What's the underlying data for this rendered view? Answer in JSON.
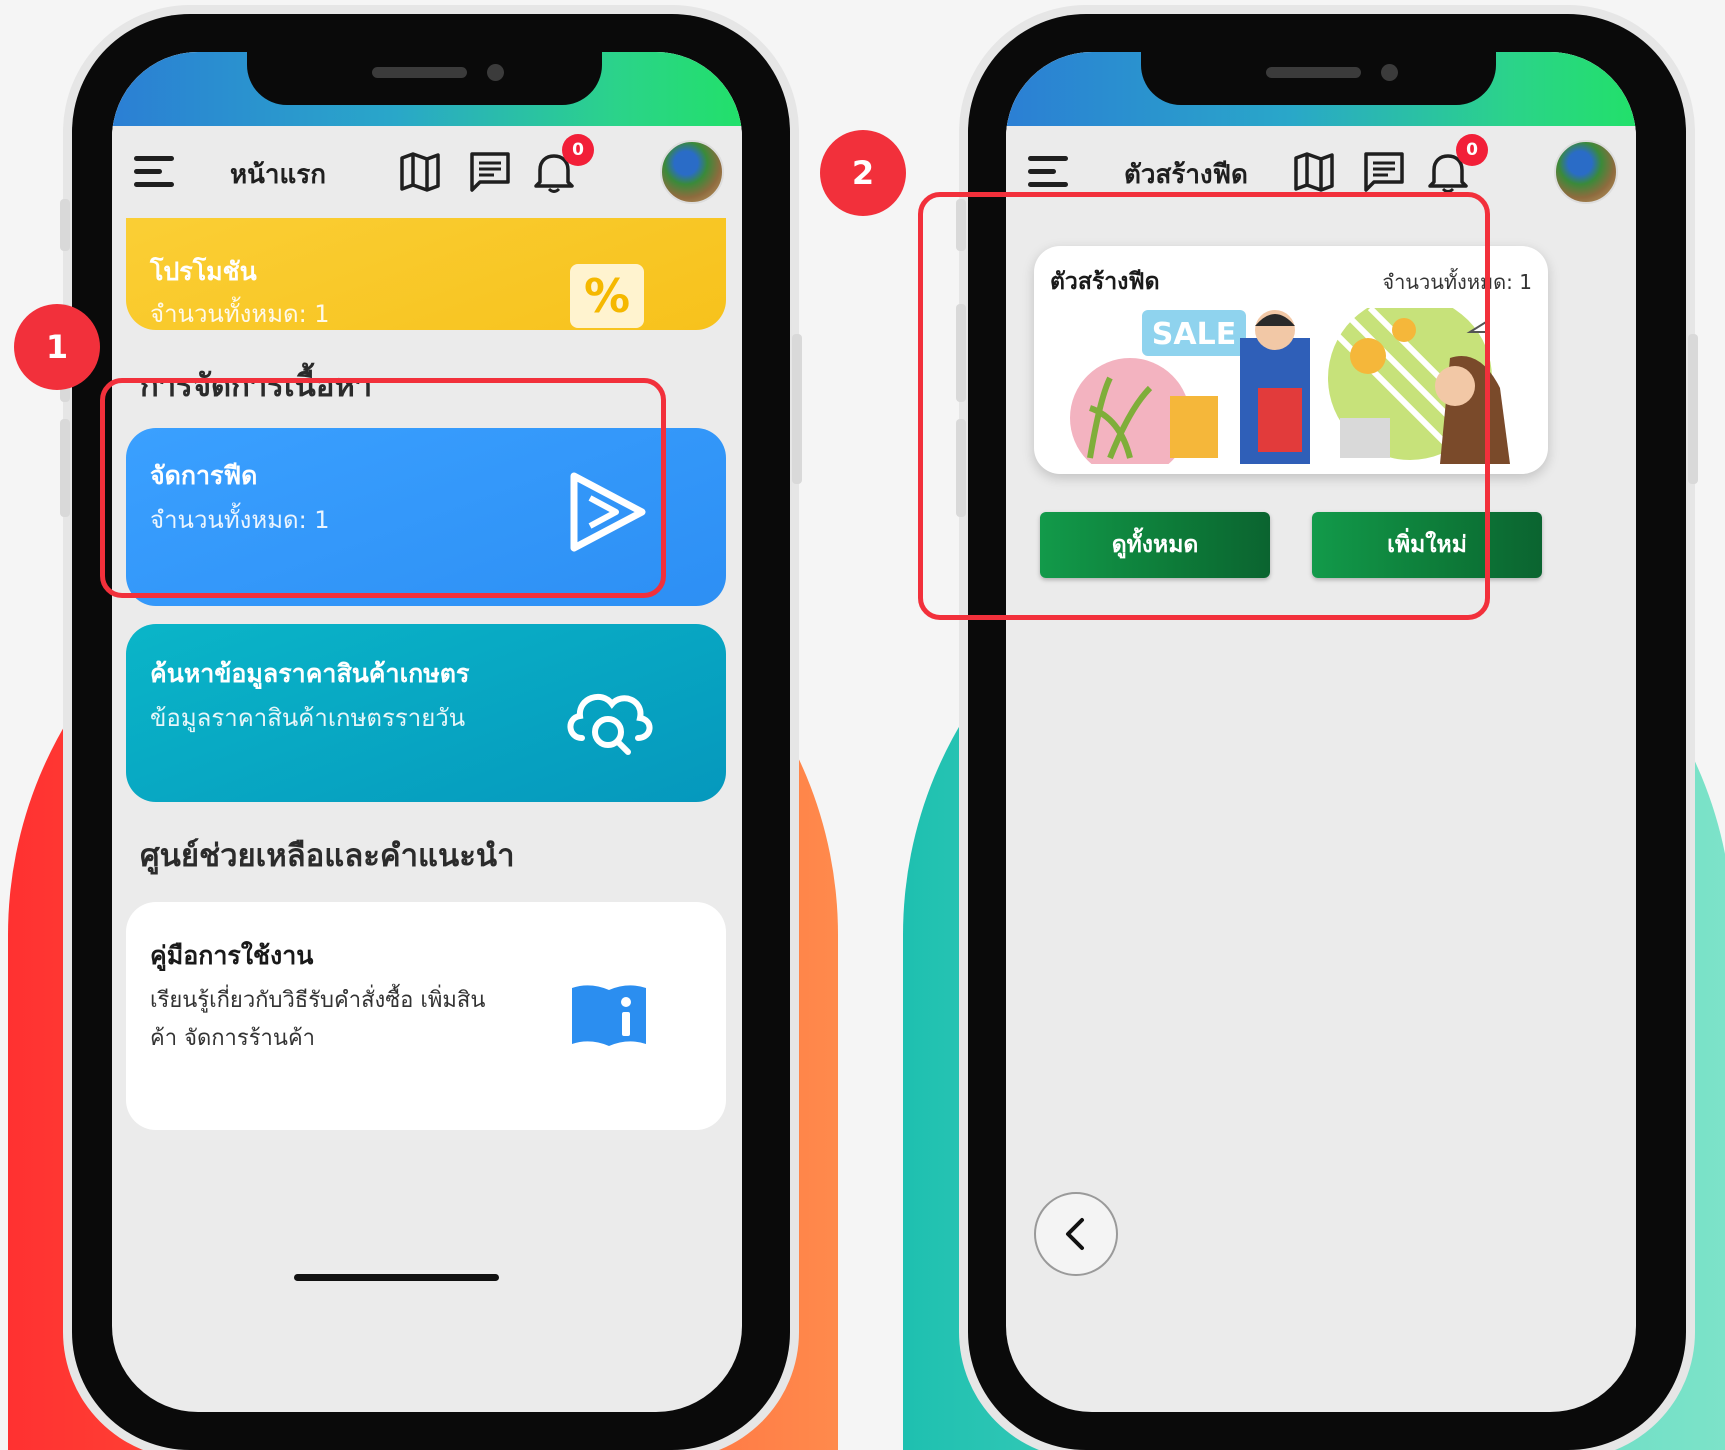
{
  "colors": {
    "highlight": "#f2303b",
    "feed_card": "#3399ff",
    "agri_card": "#0aa6c4",
    "promo_card": "#f9c72a",
    "green_button": "#0d7a38"
  },
  "steps": [
    "1",
    "2"
  ],
  "left_screen": {
    "nav": {
      "title": "หน้าแรก",
      "notification_count": "0",
      "icons": [
        "menu-icon",
        "map-icon",
        "chat-icon",
        "bell-icon"
      ]
    },
    "promo_card": {
      "title": "โปรโมชัน",
      "subtitle": "จำนวนทั้งหมด: 1",
      "icon": "percent-icon"
    },
    "content_section_title": "การจัดการเนื้อหา",
    "feed_card": {
      "title": "จัดการฟีด",
      "subtitle": "จำนวนทั้งหมด: 1",
      "icon": "play-icon"
    },
    "agri_card": {
      "title": "ค้นหาข้อมูลราคาสินค้าเกษตร",
      "subtitle": "ข้อมูลราคาสินค้าเกษตรรายวัน",
      "icon": "cloud-search-icon"
    },
    "help_section_title": "ศูนย์ช่วยเหลือและคำแนะนำ",
    "manual_card": {
      "title": "คู่มือการใช้งาน",
      "line1": "เรียนรู้เกี่ยวกับวิธีรับคำสั่งซื้อ เพิ่มสิน",
      "line2": "ค้า จัดการร้านค้า",
      "icon": "book-info-icon"
    }
  },
  "right_screen": {
    "nav": {
      "title": "ตัวสร้างฟีด",
      "notification_count": "0"
    },
    "feed_card": {
      "title": "ตัวสร้างฟีด",
      "count": "จำนวนทั้งหมด: 1",
      "image_text": "SALE"
    },
    "view_all_button": "ดูทั้งหมด",
    "add_new_button": "เพิ่มใหม่",
    "back_icon": "chevron-left-icon"
  }
}
